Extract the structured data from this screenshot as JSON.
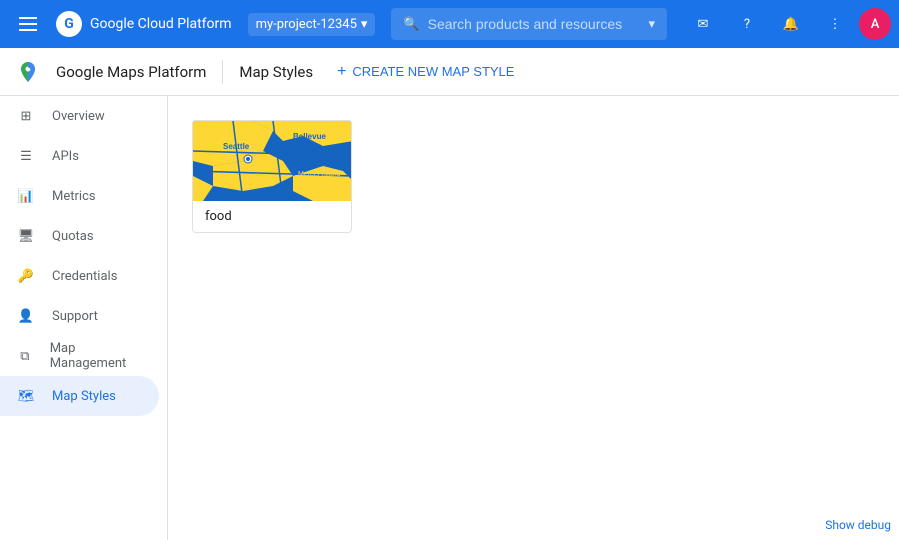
{
  "header": {
    "app_title": "Google Cloud Platform",
    "project_name": "my-project-12345",
    "search_placeholder": "Search products and resources",
    "menu_icon": "menu-icon",
    "avatar_label": "A"
  },
  "subheader": {
    "brand_title": "Google Maps Platform",
    "page_title": "Map Styles",
    "create_button_label": "CREATE NEW MAP STYLE"
  },
  "sidebar": {
    "items": [
      {
        "id": "overview",
        "label": "Overview",
        "icon": "grid-icon",
        "active": false
      },
      {
        "id": "apis",
        "label": "APIs",
        "icon": "list-icon",
        "active": false
      },
      {
        "id": "metrics",
        "label": "Metrics",
        "icon": "bar-chart-icon",
        "active": false
      },
      {
        "id": "quotas",
        "label": "Quotas",
        "icon": "monitor-icon",
        "active": false
      },
      {
        "id": "credentials",
        "label": "Credentials",
        "icon": "key-icon",
        "active": false
      },
      {
        "id": "support",
        "label": "Support",
        "icon": "person-icon",
        "active": false
      },
      {
        "id": "map-management",
        "label": "Map Management",
        "icon": "layers-icon",
        "active": false
      },
      {
        "id": "map-styles",
        "label": "Map Styles",
        "icon": "map-icon",
        "active": true
      }
    ]
  },
  "main": {
    "style_card": {
      "label": "food",
      "alt": "Seattle area map with blue and yellow style"
    }
  },
  "footer": {
    "debug_link": "Show debug"
  }
}
